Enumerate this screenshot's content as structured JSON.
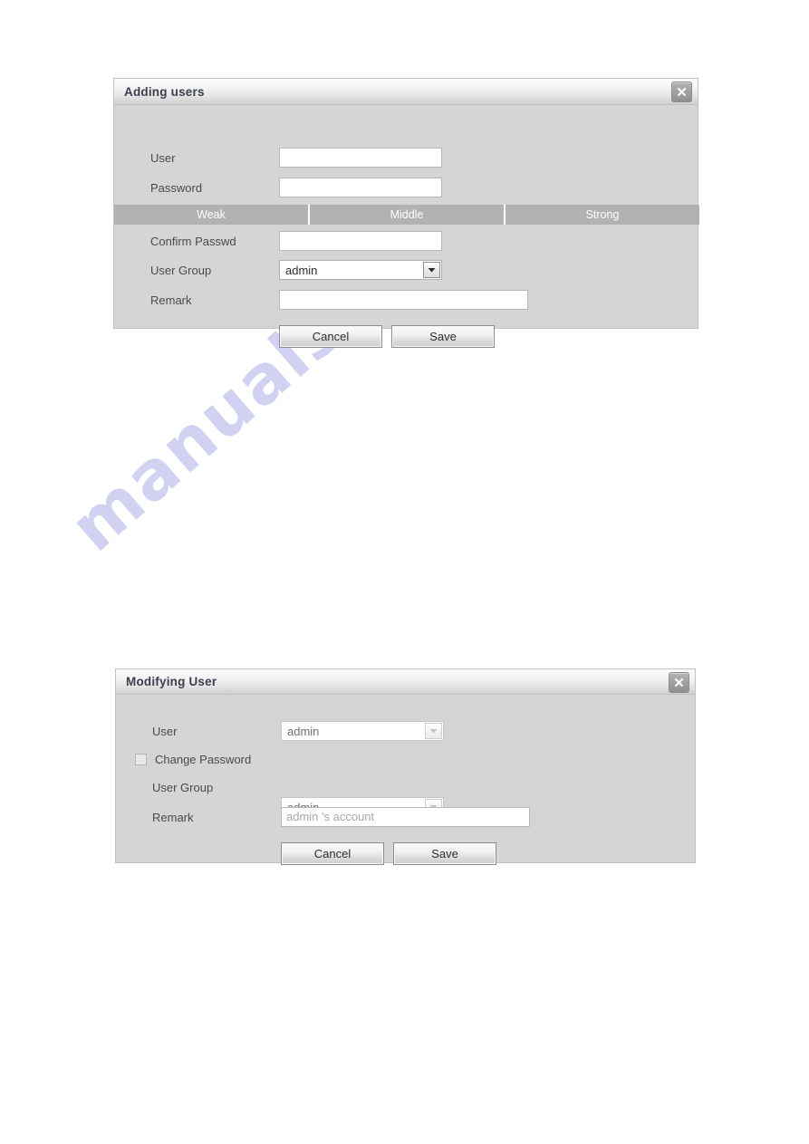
{
  "watermark": {
    "text": "manualshive.com"
  },
  "add_user_dialog": {
    "title": "Adding users",
    "close_icon": "close-icon",
    "fields": {
      "user_label": "User",
      "user_value": "",
      "password_label": "Password",
      "password_value": "",
      "confirm_label": "Confirm Passwd",
      "confirm_value": "",
      "user_group_label": "User Group",
      "user_group_value": "admin",
      "remark_label": "Remark",
      "remark_value": ""
    },
    "password_strength": {
      "weak": "Weak",
      "middle": "Middle",
      "strong": "Strong"
    },
    "buttons": {
      "cancel": "Cancel",
      "save": "Save"
    }
  },
  "modify_user_dialog": {
    "title": "Modifying User",
    "close_icon": "close-icon",
    "fields": {
      "user_label": "User",
      "user_value": "admin",
      "change_password_label": "Change Password",
      "change_password_checked": false,
      "user_group_label": "User Group",
      "user_group_value": "admin",
      "remark_label": "Remark",
      "remark_placeholder": "admin 's account"
    },
    "buttons": {
      "cancel": "Cancel",
      "save": "Save"
    }
  },
  "colors": {
    "dialog_background": "#d5d5d5",
    "strength_bar": "#b2b2b2",
    "title_text": "#3a3f4d"
  }
}
